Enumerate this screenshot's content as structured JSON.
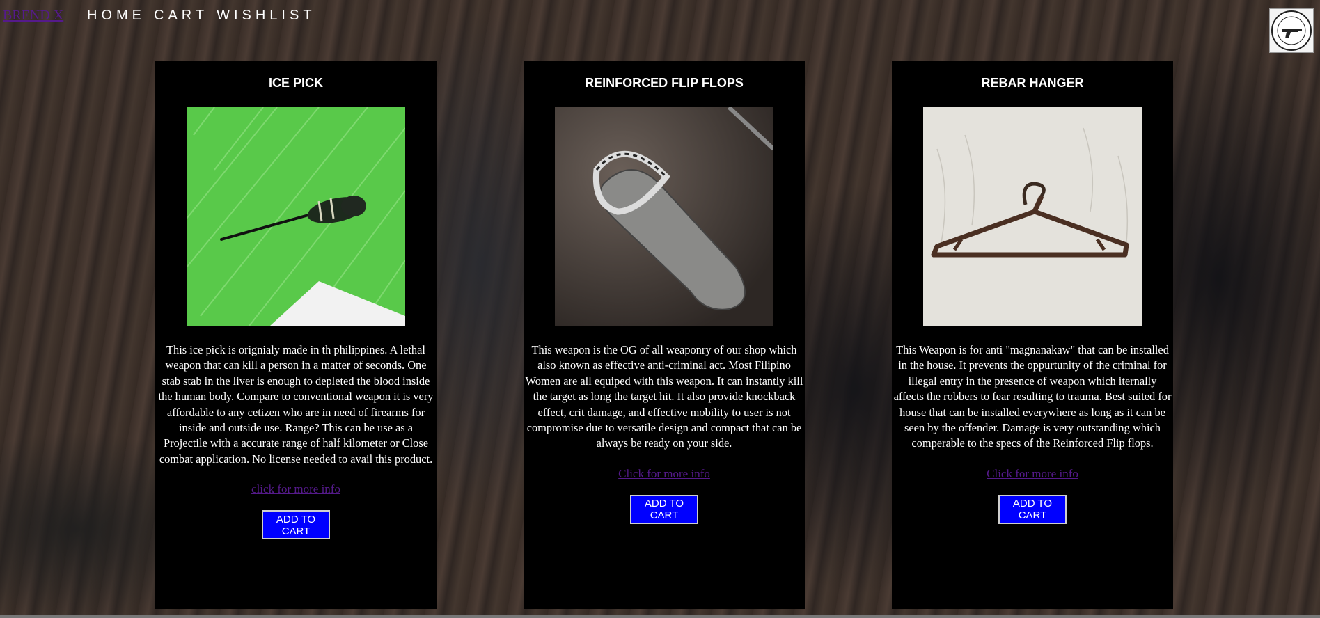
{
  "header": {
    "brand": "BREND X",
    "nav": [
      "HOME",
      "CART",
      "WISHLIST"
    ],
    "logo_icon": "tool-town-seal-logo"
  },
  "products": [
    {
      "title": "ICE PICK",
      "image_icon": "ice-pick-photo",
      "description": "This ice pick is orignialy made in th philippines. A lethal weapon that can kill a person in a matter of seconds. One stab stab in the liver is enough to depleted the blood inside the human body. Compare to conventional weapon it is very affordable to any cetizen who are in need of firearms for inside and outside use. Range? This can be use as a Projectile with a accurate range of half kilometer or Close combat application. No license needed to avail this product.",
      "more_link": "click for more info",
      "add_button": "ADD TO CART"
    },
    {
      "title": "REINFORCED FLIP FLOPS",
      "image_icon": "reinforced-flip-flop-photo",
      "description": "This weapon is the OG of all weaponry of our shop which also known as effective anti-criminal act. Most Filipino Women are all equiped with this weapon. It can instantly kill the target as long the target hit. It also provide knockback effect, crit damage, and effective mobility to user is not compromise due to versatile design and compact that can be always be ready on your side.",
      "more_link": "Click for more info",
      "add_button": "ADD TO CART"
    },
    {
      "title": "REBAR HANGER",
      "image_icon": "rebar-hanger-photo",
      "description": "This Weapon is for anti \"magnanakaw\" that can be installed in the house. It prevents the oppurtunity of the criminal for illegal entry in the presence of weapon which iternally affects the robbers to fear resulting to trauma. Best suited for house that can be installed everywhere as long as it can be seen by the offender. Damage is very outstanding which comperable to the specs of the Reinforced Flip flops.",
      "more_link": "Click for more info",
      "add_button": "ADD TO CART"
    }
  ]
}
